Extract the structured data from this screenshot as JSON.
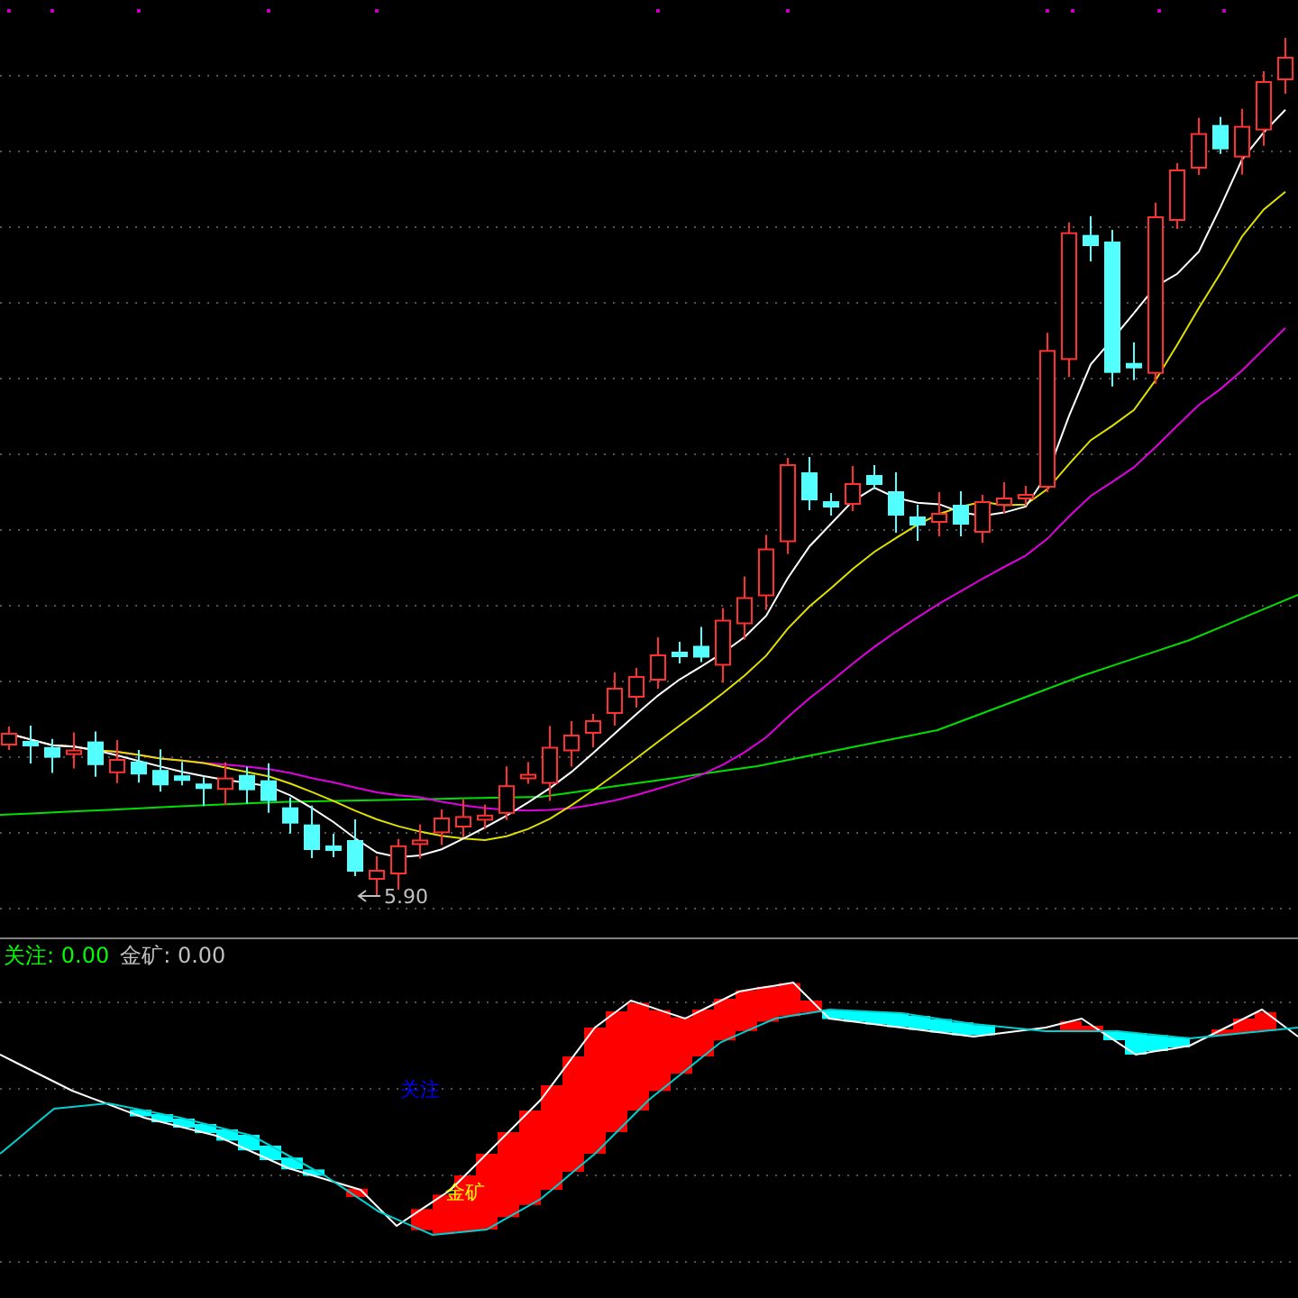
{
  "price_chart": {
    "low_label": "5.90"
  },
  "indicator": {
    "legend": [
      {
        "name": "关注:",
        "value": "0.00",
        "color": "#00ff00"
      },
      {
        "name": "金矿:",
        "value": "0.00",
        "color": "#c0c0c0"
      }
    ],
    "markers": [
      {
        "label": "关注",
        "color": "#0000ff"
      },
      {
        "label": "金矿",
        "color": "#ffff00"
      }
    ]
  }
}
